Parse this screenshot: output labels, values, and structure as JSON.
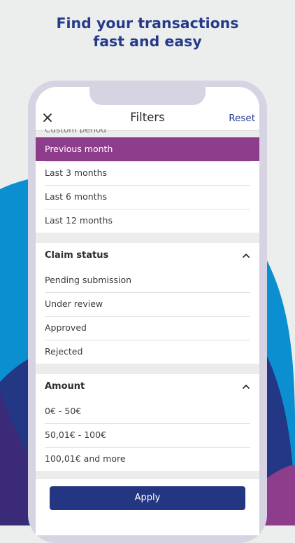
{
  "promo": {
    "line1": "Find your transactions",
    "line2": "fast and easy"
  },
  "colors": {
    "brand_navy": "#263a8a",
    "selected_purple": "#8d3d8c",
    "cyan": "#0b8fd0",
    "apply": "#243682"
  },
  "header": {
    "title": "Filters",
    "reset_label": "Reset",
    "close_icon": "close-icon",
    "clipped_text": "Custom period"
  },
  "period": {
    "items": [
      {
        "label": "Previous month",
        "selected": true
      },
      {
        "label": "Last 3 months",
        "selected": false
      },
      {
        "label": "Last 6 months",
        "selected": false
      },
      {
        "label": "Last 12 months",
        "selected": false
      }
    ]
  },
  "claim_status": {
    "title": "Claim status",
    "items": [
      "Pending submission",
      "Under review",
      "Approved",
      "Rejected"
    ]
  },
  "amount": {
    "title": "Amount",
    "items": [
      "0€ - 50€",
      "50,01€ - 100€",
      "100,01€ and more"
    ]
  },
  "footer": {
    "apply_label": "Apply"
  }
}
